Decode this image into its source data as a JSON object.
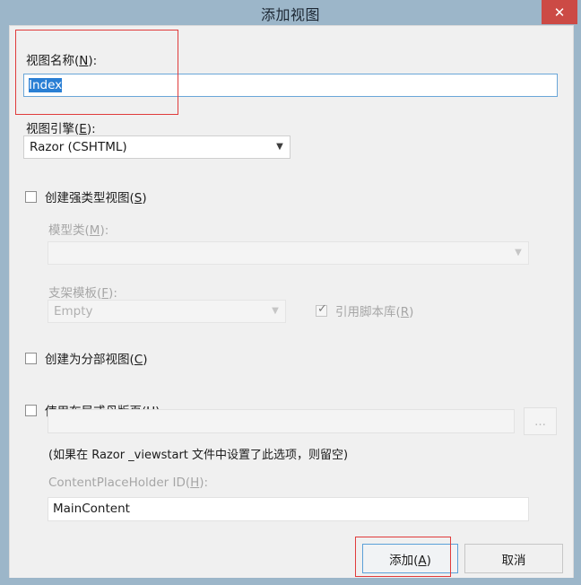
{
  "window": {
    "title": "添加视图",
    "close_label": "✕",
    "accent_close_color": "#cc4a45",
    "frame_color": "#9cb6c9"
  },
  "form": {
    "view_name_label": "视图名称(N):",
    "view_name_accesskey": "N",
    "view_name_value": "Index",
    "view_engine_label": "视图引擎(E):",
    "view_engine_accesskey": "E",
    "view_engine_value": "Razor (CSHTML)",
    "strongly_typed_label": "创建强类型视图(S)",
    "strongly_typed_accesskey": "S",
    "strongly_typed_checked": false,
    "model_class_label": "模型类(M):",
    "model_class_accesskey": "M",
    "model_class_value": "",
    "scaffold_template_label": "支架模板(F):",
    "scaffold_template_accesskey": "F",
    "scaffold_template_value": "Empty",
    "reference_scripts_label": "引用脚本库(R)",
    "reference_scripts_accesskey": "R",
    "reference_scripts_checked": true,
    "partial_view_label": "创建为分部视图(C)",
    "partial_view_accesskey": "C",
    "partial_view_checked": false,
    "use_layout_label": "使用布局或母版页(U):",
    "use_layout_accesskey": "U",
    "use_layout_checked": false,
    "layout_path_value": "",
    "browse_label": "...",
    "layout_hint": "(如果在 Razor _viewstart 文件中设置了此选项，则留空)",
    "placeholder_id_label": "ContentPlaceHolder ID(H):",
    "placeholder_id_accesskey": "H",
    "placeholder_id_value": "MainContent"
  },
  "footer": {
    "add_label": "添加(A)",
    "add_accesskey": "A",
    "cancel_label": "取消"
  },
  "annotations": {
    "color": "#e03b3b",
    "regions": [
      "view-name-group",
      "add-button"
    ]
  }
}
